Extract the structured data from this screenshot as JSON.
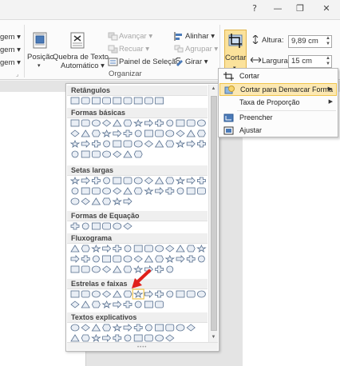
{
  "window": {
    "help": "?",
    "minimize": "—",
    "restore": "❐",
    "close": "✕"
  },
  "ribbon": {
    "left_items": [
      "gem ▾",
      "gem ▾",
      "gem ▾"
    ],
    "position": "Posição",
    "wrap_text": [
      "Quebra de Texto",
      "Automático ▾"
    ],
    "bring_forward": "Avançar ▾",
    "send_backward": "Recuar ▾",
    "selection_pane": "Painel de Seleção",
    "align": "Alinhar ▾",
    "group": "Agrupar ▾",
    "rotate": "Girar ▾",
    "arrange_group": "Organizar",
    "crop": "Cortar",
    "height_label": "Altura:",
    "height_value": "9,89 cm",
    "width_label": "Largura:",
    "width_value": "15 cm"
  },
  "gallery": {
    "categories": [
      "Retângulos",
      "Formas básicas",
      "Setas largas",
      "Formas de Equação",
      "Fluxograma",
      "Estrelas e faixas",
      "Textos explicativos"
    ]
  },
  "crop_menu": {
    "items": [
      {
        "label": "Cortar"
      },
      {
        "label": "Cortar para Demarcar Forma"
      },
      {
        "label": "Taxa de Proporção"
      },
      {
        "label": "Preencher"
      },
      {
        "label": "Ajustar"
      }
    ]
  },
  "colors": {
    "highlight": "#fce8b2",
    "highlight_border": "#f0c54e",
    "arrow": "#e0201b",
    "shape_stroke": "#58708f",
    "shape_fill": "#e9eef5"
  }
}
